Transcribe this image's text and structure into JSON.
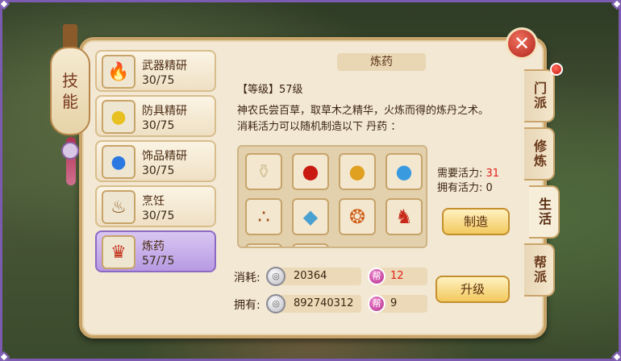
{
  "panel": {
    "side_title_chars": [
      "技",
      "能"
    ],
    "close_icon": "close-x-icon"
  },
  "tabs": [
    {
      "label": "门派"
    },
    {
      "label": "修炼"
    },
    {
      "label": "生活"
    },
    {
      "label": "帮派"
    }
  ],
  "skills": [
    {
      "name": "武器精研",
      "level": "30/75",
      "icon": "red-flame-orb-icon"
    },
    {
      "name": "防具精研",
      "level": "30/75",
      "icon": "yellow-flame-orb-icon"
    },
    {
      "name": "饰品精研",
      "level": "30/75",
      "icon": "blue-flame-orb-icon"
    },
    {
      "name": "烹饪",
      "level": "30/75",
      "icon": "cooking-pot-icon"
    },
    {
      "name": "炼药",
      "level": "57/75",
      "icon": "alchemy-cauldron-icon"
    }
  ],
  "detail": {
    "title": "炼药",
    "level_line": "【等级】57级",
    "desc_line1": "神农氏尝百草，取草木之精华，火炼而得的炼丹之术。",
    "desc_line2": "消耗活力可以随机制造以下  丹药  ："
  },
  "items": [
    {
      "icon": "jar-icon"
    },
    {
      "icon": "red-gourd-icon"
    },
    {
      "icon": "gold-orb-icon"
    },
    {
      "icon": "blue-orb-icon"
    },
    {
      "icon": "pills-icon"
    },
    {
      "icon": "pill-cloth-icon"
    },
    {
      "icon": "beads-icon"
    },
    {
      "icon": "lion-gourd-icon"
    }
  ],
  "vitality": {
    "required_label": "需要活力:",
    "required_value": "31",
    "owned_label": "拥有活力:",
    "owned_value": "0"
  },
  "buttons": {
    "make": "制造",
    "upgrade": "升级"
  },
  "cost": {
    "consume_label": "消耗:",
    "consume_silver": "20364",
    "consume_bang": "12",
    "own_label": "拥有:",
    "own_silver": "892740312",
    "own_bang": "9",
    "bang_glyph": "帮"
  },
  "colors": {
    "accent_red": "#e0201a",
    "selected_purple": "#b79ae3"
  }
}
